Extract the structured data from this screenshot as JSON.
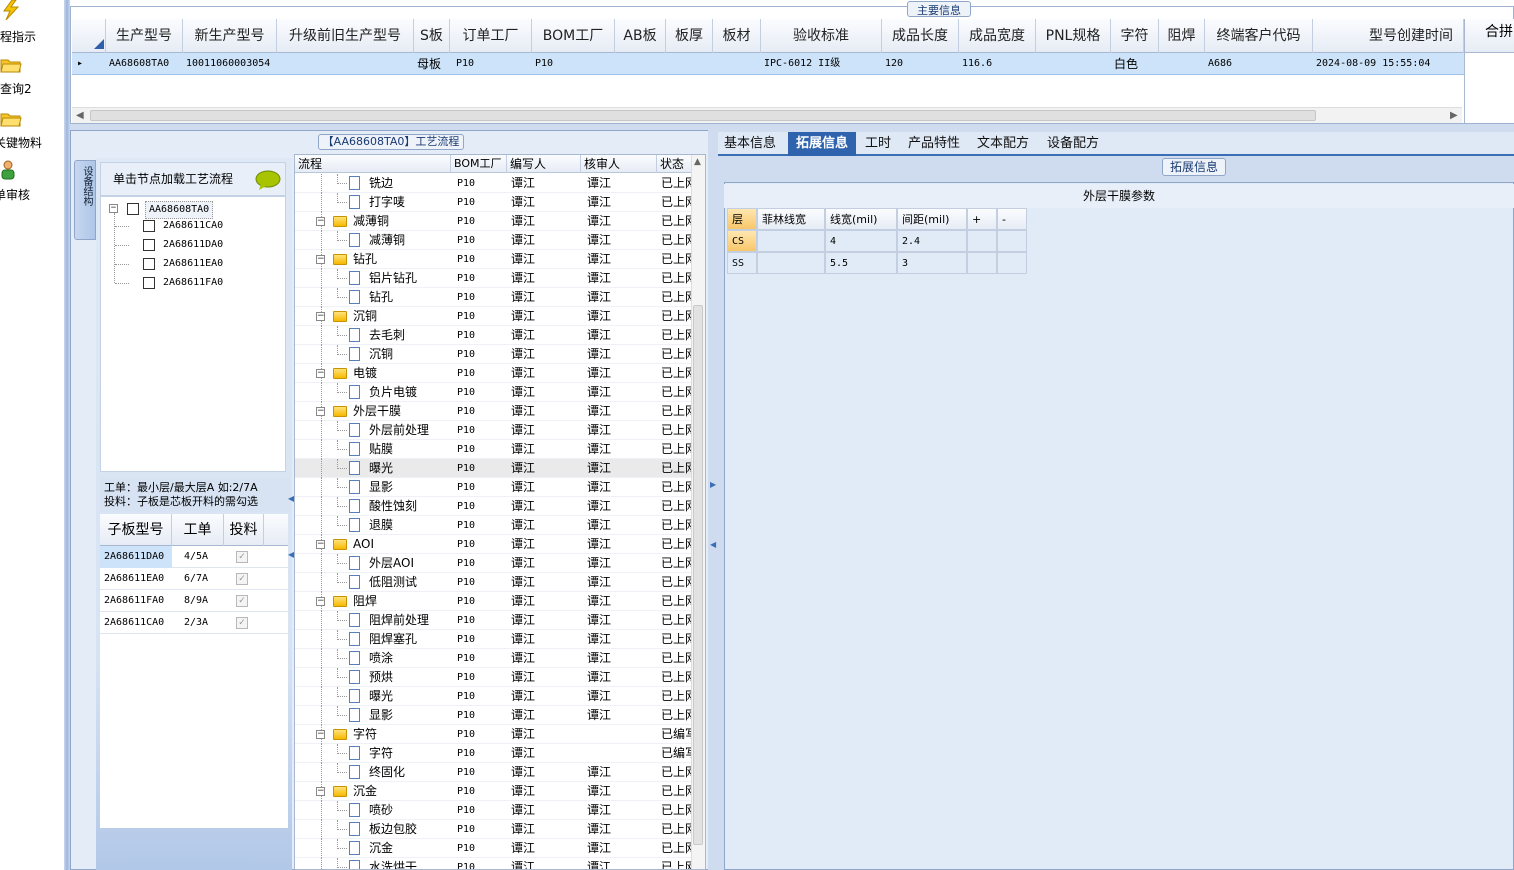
{
  "left_toolbar": {
    "items": [
      {
        "label": "程指示",
        "icon": "lightning-icon"
      },
      {
        "label": "查询2",
        "icon": "folder-open-icon"
      },
      {
        "label": "关键物料",
        "icon": "folder-open-icon"
      },
      {
        "label": "单审核",
        "icon": "user-icon"
      }
    ]
  },
  "main_info": {
    "title": "主要信息",
    "columns": [
      "生产型号",
      "新生产型号",
      "升级前旧生产型号",
      "S板",
      "订单工厂",
      "BOM工厂",
      "AB板",
      "板厚",
      "板材",
      "验收标准",
      "成品长度",
      "成品宽度",
      "PNL规格",
      "字符",
      "阻焊",
      "终端客户代码",
      "型号创建时间"
    ],
    "merge_header": "合拼",
    "row": {
      "生产型号": "AA68608TA0",
      "新生产型号": "10011060003054",
      "升级前旧生产型号": "",
      "S板": "母板",
      "订单工厂": "P10",
      "BOM工厂": "P10",
      "AB板": "",
      "板厚": "",
      "板材": "",
      "验收标准": "IPC-6012 II级",
      "成品长度": "120",
      "成品宽度": "116.6",
      "PNL规格": "",
      "字符": "白色",
      "阻焊": "",
      "终端客户代码": "A686",
      "型号创建时间": "2024-08-09 15:55:04"
    },
    "row_marker": "▸"
  },
  "process": {
    "title": "【AA68608TA0】工艺流程",
    "side_tab": "设备结构",
    "load_hint": "单击节点加载工艺流程",
    "tree": {
      "root": "AA68608TA0",
      "children": [
        "2A68611CA0",
        "2A68611DA0",
        "2A68611EA0",
        "2A68611FA0"
      ]
    },
    "note_line1": "工单：最小层/最大层A 如:2/7A",
    "note_line2": "投料：子板是芯板开料的需勾选",
    "sub_table": {
      "headers": [
        "子板型号",
        "工单",
        "投料"
      ],
      "rows": [
        {
          "model": "2A68611DA0",
          "order": "4/5A",
          "feed": "✓"
        },
        {
          "model": "2A68611EA0",
          "order": "6/7A",
          "feed": "✓"
        },
        {
          "model": "2A68611FA0",
          "order": "8/9A",
          "feed": "✓"
        },
        {
          "model": "2A68611CA0",
          "order": "2/3A",
          "feed": "✓"
        }
      ]
    },
    "flow_headers": [
      "流程",
      "BOM工厂",
      "编写人",
      "核审人",
      "状态"
    ],
    "flow_rows": [
      {
        "name": "铣边",
        "type": "child",
        "bom": "P10",
        "writer": "谭江",
        "reviewer": "谭江",
        "status": "已上网"
      },
      {
        "name": "打字唛",
        "type": "child",
        "bom": "P10",
        "writer": "谭江",
        "reviewer": "谭江",
        "status": "已上网"
      },
      {
        "name": "减薄铜",
        "type": "group",
        "bom": "P10",
        "writer": "谭江",
        "reviewer": "谭江",
        "status": "已上网"
      },
      {
        "name": "减薄铜",
        "type": "child",
        "bom": "P10",
        "writer": "谭江",
        "reviewer": "谭江",
        "status": "已上网"
      },
      {
        "name": "钻孔",
        "type": "group",
        "bom": "P10",
        "writer": "谭江",
        "reviewer": "谭江",
        "status": "已上网"
      },
      {
        "name": "铝片钻孔",
        "type": "child",
        "bom": "P10",
        "writer": "谭江",
        "reviewer": "谭江",
        "status": "已上网"
      },
      {
        "name": "钻孔",
        "type": "child",
        "bom": "P10",
        "writer": "谭江",
        "reviewer": "谭江",
        "status": "已上网"
      },
      {
        "name": "沉铜",
        "type": "group",
        "bom": "P10",
        "writer": "谭江",
        "reviewer": "谭江",
        "status": "已上网"
      },
      {
        "name": "去毛刺",
        "type": "child",
        "bom": "P10",
        "writer": "谭江",
        "reviewer": "谭江",
        "status": "已上网"
      },
      {
        "name": "沉铜",
        "type": "child",
        "bom": "P10",
        "writer": "谭江",
        "reviewer": "谭江",
        "status": "已上网"
      },
      {
        "name": "电镀",
        "type": "group",
        "bom": "P10",
        "writer": "谭江",
        "reviewer": "谭江",
        "status": "已上网"
      },
      {
        "name": "负片电镀",
        "type": "child",
        "bom": "P10",
        "writer": "谭江",
        "reviewer": "谭江",
        "status": "已上网"
      },
      {
        "name": "外层干膜",
        "type": "group",
        "bom": "P10",
        "writer": "谭江",
        "reviewer": "谭江",
        "status": "已上网"
      },
      {
        "name": "外层前处理",
        "type": "child",
        "bom": "P10",
        "writer": "谭江",
        "reviewer": "谭江",
        "status": "已上网"
      },
      {
        "name": "贴膜",
        "type": "child",
        "bom": "P10",
        "writer": "谭江",
        "reviewer": "谭江",
        "status": "已上网"
      },
      {
        "name": "曝光",
        "type": "child",
        "bom": "P10",
        "writer": "谭江",
        "reviewer": "谭江",
        "status": "已上网",
        "selected": true
      },
      {
        "name": "显影",
        "type": "child",
        "bom": "P10",
        "writer": "谭江",
        "reviewer": "谭江",
        "status": "已上网"
      },
      {
        "name": "酸性蚀刻",
        "type": "child",
        "bom": "P10",
        "writer": "谭江",
        "reviewer": "谭江",
        "status": "已上网"
      },
      {
        "name": "退膜",
        "type": "child",
        "bom": "P10",
        "writer": "谭江",
        "reviewer": "谭江",
        "status": "已上网"
      },
      {
        "name": "AOI",
        "type": "group",
        "bom": "P10",
        "writer": "谭江",
        "reviewer": "谭江",
        "status": "已上网"
      },
      {
        "name": "外层AOI",
        "type": "child",
        "bom": "P10",
        "writer": "谭江",
        "reviewer": "谭江",
        "status": "已上网"
      },
      {
        "name": "低阻测试",
        "type": "child",
        "bom": "P10",
        "writer": "谭江",
        "reviewer": "谭江",
        "status": "已上网"
      },
      {
        "name": "阻焊",
        "type": "group",
        "bom": "P10",
        "writer": "谭江",
        "reviewer": "谭江",
        "status": "已上网"
      },
      {
        "name": "阻焊前处理",
        "type": "child",
        "bom": "P10",
        "writer": "谭江",
        "reviewer": "谭江",
        "status": "已上网"
      },
      {
        "name": "阻焊塞孔",
        "type": "child",
        "bom": "P10",
        "writer": "谭江",
        "reviewer": "谭江",
        "status": "已上网"
      },
      {
        "name": "喷涂",
        "type": "child",
        "bom": "P10",
        "writer": "谭江",
        "reviewer": "谭江",
        "status": "已上网"
      },
      {
        "name": "预烘",
        "type": "child",
        "bom": "P10",
        "writer": "谭江",
        "reviewer": "谭江",
        "status": "已上网"
      },
      {
        "name": "曝光",
        "type": "child",
        "bom": "P10",
        "writer": "谭江",
        "reviewer": "谭江",
        "status": "已上网"
      },
      {
        "name": "显影",
        "type": "child",
        "bom": "P10",
        "writer": "谭江",
        "reviewer": "谭江",
        "status": "已上网"
      },
      {
        "name": "字符",
        "type": "group",
        "bom": "P10",
        "writer": "谭江",
        "reviewer": "",
        "status": "已编写"
      },
      {
        "name": "字符",
        "type": "child",
        "bom": "P10",
        "writer": "谭江",
        "reviewer": "",
        "status": "已编写"
      },
      {
        "name": "终固化",
        "type": "child",
        "bom": "P10",
        "writer": "谭江",
        "reviewer": "谭江",
        "status": "已上网"
      },
      {
        "name": "沉金",
        "type": "group",
        "bom": "P10",
        "writer": "谭江",
        "reviewer": "谭江",
        "status": "已上网"
      },
      {
        "name": "喷砂",
        "type": "child",
        "bom": "P10",
        "writer": "谭江",
        "reviewer": "谭江",
        "status": "已上网"
      },
      {
        "name": "板边包胶",
        "type": "child",
        "bom": "P10",
        "writer": "谭江",
        "reviewer": "谭江",
        "status": "已上网"
      },
      {
        "name": "沉金",
        "type": "child",
        "bom": "P10",
        "writer": "谭江",
        "reviewer": "谭江",
        "status": "已上网"
      },
      {
        "name": "水洗烘干",
        "type": "child",
        "bom": "P10",
        "writer": "谭江",
        "reviewer": "谭江",
        "status": "已上网"
      }
    ]
  },
  "right_tabs": [
    "基本信息",
    "拓展信息",
    "工时",
    "产品特性",
    "文本配方",
    "设备配方"
  ],
  "active_tab": "拓展信息",
  "extension": {
    "title": "拓展信息",
    "section": "外层干膜参数",
    "headers": [
      "层",
      "菲林线宽",
      "线宽(mil)",
      "间距(mil)",
      "+",
      "-"
    ],
    "rows": [
      {
        "layer": "CS",
        "film": "",
        "width": "4",
        "space": "2.4"
      },
      {
        "layer": "SS",
        "film": "",
        "width": "5.5",
        "space": "3"
      }
    ]
  }
}
